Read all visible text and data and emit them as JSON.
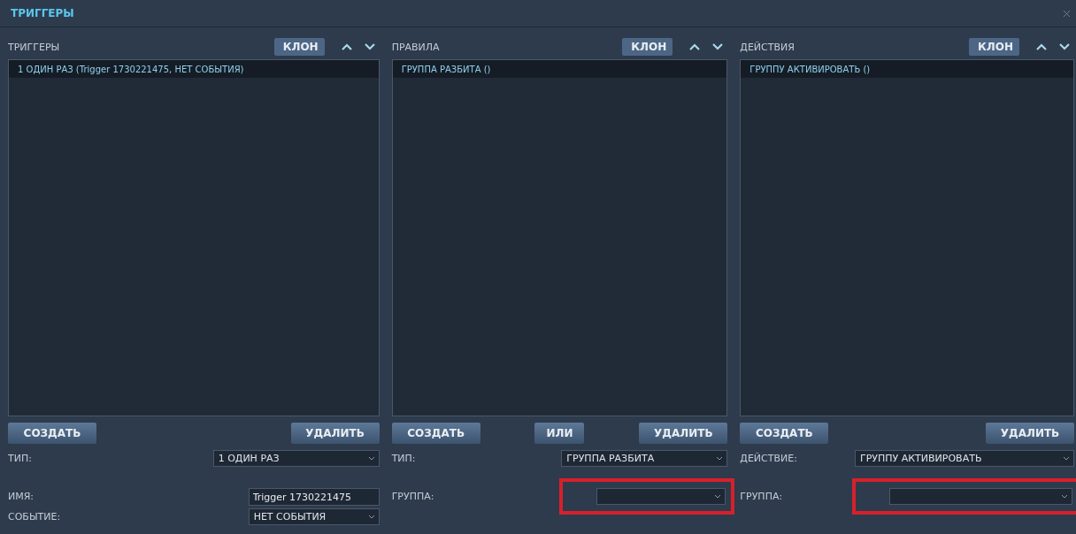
{
  "window": {
    "title": "ТРИГГЕРЫ"
  },
  "columns": [
    {
      "title": "ТРИГГЕРЫ",
      "clone": "КЛОН",
      "items": [
        {
          "text": "1 ОДИН РАЗ (Trigger 1730221475, НЕТ СОБЫТИЯ)",
          "selected": true
        }
      ],
      "buttons": [
        "СОЗДАТЬ",
        "УДАЛИТЬ"
      ],
      "fields": [
        {
          "kind": "select",
          "label": "ТИП:",
          "value": "1 ОДИН РАЗ",
          "highlighted": false
        },
        {
          "kind": "input",
          "label": "ИМЯ:",
          "value": "Trigger 1730221475",
          "highlighted": false
        },
        {
          "kind": "select",
          "label": "СОБЫТИЕ:",
          "value": "НЕТ СОБЫТИЯ",
          "highlighted": false
        }
      ]
    },
    {
      "title": "ПРАВИЛА",
      "clone": "КЛОН",
      "items": [
        {
          "text": "ГРУППА РАЗБИТА ()",
          "selected": true
        }
      ],
      "buttons": [
        "СОЗДАТЬ",
        "ИЛИ",
        "УДАЛИТЬ"
      ],
      "fields": [
        {
          "kind": "select",
          "label": "ТИП:",
          "value": "ГРУППА РАЗБИТА",
          "highlighted": false
        },
        {
          "kind": "select",
          "label": "ГРУППА:",
          "highlighted": true
        }
      ]
    },
    {
      "title": "ДЕЙСТВИЯ",
      "clone": "КЛОН",
      "items": [
        {
          "text": "ГРУППУ АКТИВИРОВАТЬ ()",
          "selected": true
        }
      ],
      "buttons": [
        "СОЗДАТЬ",
        "УДАЛИТЬ"
      ],
      "fields": [
        {
          "kind": "select",
          "label": "ДЕЙСТВИЕ:",
          "value": "ГРУППУ АКТИВИРОВАТЬ",
          "highlighted": false
        },
        {
          "kind": "select",
          "label": "ГРУППА:",
          "highlighted": true
        }
      ]
    }
  ]
}
